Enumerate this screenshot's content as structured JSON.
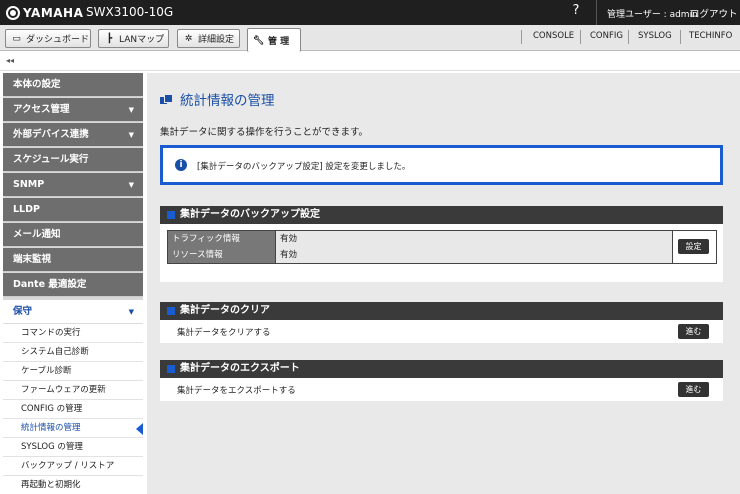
{
  "header": {
    "brand": "YAMAHA",
    "model": "SWX3100-10G",
    "help": "?",
    "user": "管理ユーザー : admin",
    "logout": "ログアウト"
  },
  "tabs": [
    {
      "label": "ダッシュボード",
      "icon": "dashboard-icon"
    },
    {
      "label": "LANマップ",
      "icon": "lanmap-icon"
    },
    {
      "label": "詳細設定",
      "icon": "gear-icon"
    },
    {
      "label": "管 理",
      "icon": "wrench-icon"
    }
  ],
  "right_links": [
    "CONSOLE",
    "CONFIG",
    "SYSLOG",
    "TECHINFO"
  ],
  "collapse_glyph": "◂◂",
  "sidebar": {
    "items": [
      {
        "label": "本体の設定",
        "arrow": ""
      },
      {
        "label": "アクセス管理",
        "arrow": "▼"
      },
      {
        "label": "外部デバイス連携",
        "arrow": "▼"
      },
      {
        "label": "スケジュール実行",
        "arrow": ""
      },
      {
        "label": "SNMP",
        "arrow": "▼"
      },
      {
        "label": "LLDP",
        "arrow": ""
      },
      {
        "label": "メール通知",
        "arrow": ""
      },
      {
        "label": "端末監視",
        "arrow": ""
      },
      {
        "label": "Dante 最適設定",
        "arrow": ""
      },
      {
        "label": "保守",
        "arrow": "▼"
      }
    ],
    "subitems": [
      "コマンドの実行",
      "システム自己診断",
      "ケーブル診断",
      "ファームウェアの更新",
      "CONFIG の管理",
      "統計情報の管理",
      "SYSLOG の管理",
      "バックアップ / リストア",
      "再起動と初期化"
    ]
  },
  "main": {
    "title": "統計情報の管理",
    "description": "集計データに関する操作を行うことができます。",
    "notice": "[集計データのバックアップ設定] 設定を変更しました。",
    "backup": {
      "title": "集計データのバックアップ設定",
      "rows": [
        {
          "key": "トラフィック情報",
          "value": "有効"
        },
        {
          "key": "リソース情報",
          "value": "有効"
        }
      ],
      "button": "設定"
    },
    "clear": {
      "title": "集計データのクリア",
      "text": "集計データをクリアする",
      "button": "進む"
    },
    "export": {
      "title": "集計データのエクスポート",
      "text": "集計データをエクスポートする",
      "button": "進む"
    }
  }
}
